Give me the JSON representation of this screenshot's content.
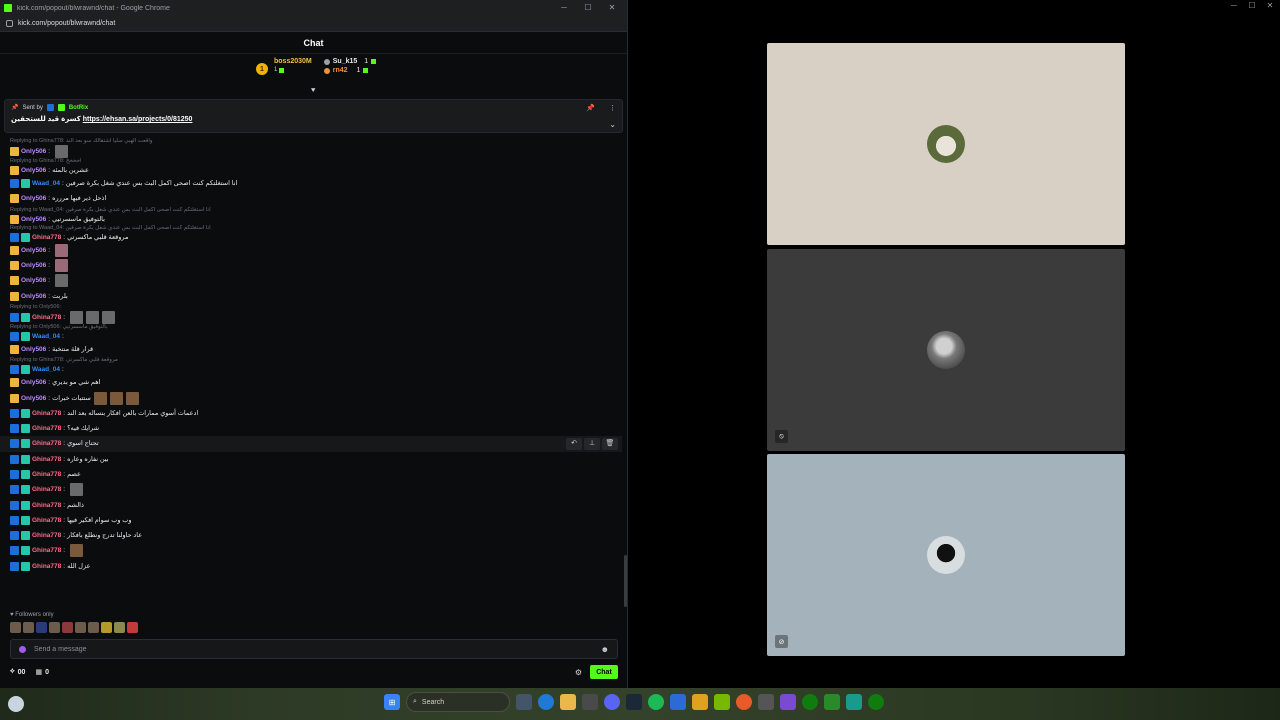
{
  "browser": {
    "window_title": "kick.com/popout/blwrawnd/chat - Google Chrome",
    "url": "kick.com/popout/blwrawnd/chat"
  },
  "chat": {
    "title": "Chat",
    "leaderboard": {
      "rank": "1",
      "first": {
        "name": "boss2030M",
        "count": "1"
      },
      "second": {
        "name": "Su_k15",
        "count": "1"
      },
      "third": {
        "name": "rn42",
        "count": "1"
      }
    },
    "pinned": {
      "sent_by_label": "Sent by",
      "sender": "BotRix",
      "text": "كسرة قيد للستحقين",
      "link": "https://ehsan.sa/projects/0/81250"
    },
    "messages": [
      {
        "reply": "Replying to Ghina778: واقعت الهبي سليا اشتقالك سو بعد الند",
        "badges": [
          "crown"
        ],
        "user": "Only506",
        "cls": "only",
        "text": "",
        "emotes": [
          "gray"
        ]
      },
      {
        "reply": "Replying to Ghina778: اخخخخ",
        "badges": [
          "crown"
        ],
        "user": "Only506",
        "cls": "only",
        "text": "عشرين بالمئه",
        "emotes": []
      },
      {
        "reply": "",
        "badges": [
          "blue",
          "teal"
        ],
        "user": "Waad_04",
        "cls": "waad",
        "text": "انا استغلتكم كنت اصحى اكمل البث بس عندي شغل بكرة صرفين",
        "emotes": []
      },
      {
        "reply": "",
        "badges": [
          "crown"
        ],
        "user": "Only506",
        "cls": "only",
        "text": "اذحل ذير فيها مررره",
        "emotes": []
      },
      {
        "reply": "Replying to Waad_04: انا استغلتكم كنت اصحى اكمل البث بس عندي شغل بكرة صرفين",
        "badges": [
          "crown"
        ],
        "user": "Only506",
        "cls": "only",
        "text": "بالتوفيق ماسسرتيي",
        "emotes": []
      },
      {
        "reply": "Replying to Waad_04: انا استغلتكم كنت اصحى اكمل البث بس عندي شغل بكرة صرفين",
        "badges": [
          "blue",
          "teal"
        ],
        "user": "Ghina778",
        "cls": "ghina",
        "text": "مروقعة قلبي ماكسرتي",
        "emotes": []
      },
      {
        "reply": "",
        "badges": [
          "crown"
        ],
        "user": "Only506",
        "cls": "only",
        "text": "",
        "emotes": [
          "pink"
        ]
      },
      {
        "reply": "",
        "badges": [
          "crown"
        ],
        "user": "Only506",
        "cls": "only",
        "text": "",
        "emotes": [
          "pink"
        ]
      },
      {
        "reply": "",
        "badges": [
          "crown"
        ],
        "user": "Only506",
        "cls": "only",
        "text": "",
        "emotes": [
          "gray"
        ]
      },
      {
        "reply": "",
        "badges": [
          "crown"
        ],
        "user": "Only506",
        "cls": "only",
        "text": "بلربت",
        "emotes": []
      },
      {
        "reply": "Replying to Only506:",
        "badges": [
          "blue",
          "teal"
        ],
        "user": "Ghina778",
        "cls": "ghina",
        "text": "",
        "emotes": [
          "gray",
          "gray",
          "gray"
        ]
      },
      {
        "reply": "Replying to Only506: بالتوفيق ماسسرتيي",
        "badges": [
          "blue",
          "teal"
        ],
        "user": "Waad_04",
        "cls": "waad",
        "text": "",
        "emotes": []
      },
      {
        "reply": "",
        "badges": [
          "crown"
        ],
        "user": "Only506",
        "cls": "only",
        "text": "قرار قلة منتخبة",
        "emotes": []
      },
      {
        "reply": "Replying to Ghina778: مروقعة قلبي ماكسرتي",
        "badges": [
          "blue",
          "teal"
        ],
        "user": "Waad_04",
        "cls": "waad",
        "text": "",
        "emotes": []
      },
      {
        "reply": "",
        "badges": [
          "crown"
        ],
        "user": "Only506",
        "cls": "only",
        "text": "اهم شي مو بديري",
        "emotes": []
      },
      {
        "reply": "",
        "badges": [
          "crown"
        ],
        "user": "Only506",
        "cls": "only",
        "text": "ستتبات خبرات",
        "emotes": [
          "brown",
          "brown",
          "brown"
        ]
      },
      {
        "reply": "",
        "badges": [
          "blue",
          "teal"
        ],
        "user": "Ghina778",
        "cls": "ghina",
        "text": "ادعمات أسوي ممارات بالعن افكار بنساله بعد الند",
        "emotes": []
      },
      {
        "reply": "",
        "badges": [
          "blue",
          "teal"
        ],
        "user": "Ghina778",
        "cls": "ghina",
        "text": "شرايك فيه؟",
        "emotes": []
      },
      {
        "reply": "",
        "badges": [
          "blue",
          "teal"
        ],
        "user": "Ghina778",
        "cls": "ghina",
        "text": "تحتاج اسوي",
        "emotes": [],
        "hover": true
      },
      {
        "reply": "",
        "badges": [
          "blue",
          "teal"
        ],
        "user": "Ghina778",
        "cls": "ghina",
        "text": "بين نفاره وعاره",
        "emotes": []
      },
      {
        "reply": "",
        "badges": [
          "blue",
          "teal"
        ],
        "user": "Ghina778",
        "cls": "ghina",
        "text": "عصم",
        "emotes": []
      },
      {
        "reply": "",
        "badges": [
          "blue",
          "teal"
        ],
        "user": "Ghina778",
        "cls": "ghina",
        "text": "",
        "emotes": [
          "gray"
        ]
      },
      {
        "reply": "",
        "badges": [
          "blue",
          "teal"
        ],
        "user": "Ghina778",
        "cls": "ghina",
        "text": "ذالشم",
        "emotes": []
      },
      {
        "reply": "",
        "badges": [
          "blue",
          "teal"
        ],
        "user": "Ghina778",
        "cls": "ghina",
        "text": "وب وب سوام افكير فيها",
        "emotes": []
      },
      {
        "reply": "",
        "badges": [
          "blue",
          "teal"
        ],
        "user": "Ghina778",
        "cls": "ghina",
        "text": "عاد حاولنا تدرج ونطلع بافكار",
        "emotes": []
      },
      {
        "reply": "",
        "badges": [
          "blue",
          "teal"
        ],
        "user": "Ghina778",
        "cls": "ghina",
        "text": "",
        "emotes": [
          "brown"
        ]
      },
      {
        "reply": "",
        "badges": [
          "blue",
          "teal"
        ],
        "user": "Ghina778",
        "cls": "ghina",
        "text": "عزل الله",
        "emotes": []
      }
    ],
    "followers_only": "Followers only",
    "input_placeholder": "Send a message",
    "viewers": "00",
    "count2": "0",
    "send_label": "Chat"
  },
  "taskbar": {
    "search_placeholder": "Search"
  },
  "colors": {
    "kick_green": "#53fc18",
    "tile1": "#d8d0c4",
    "tile2": "#3b3b3b",
    "tile3": "#a4b2bb"
  }
}
